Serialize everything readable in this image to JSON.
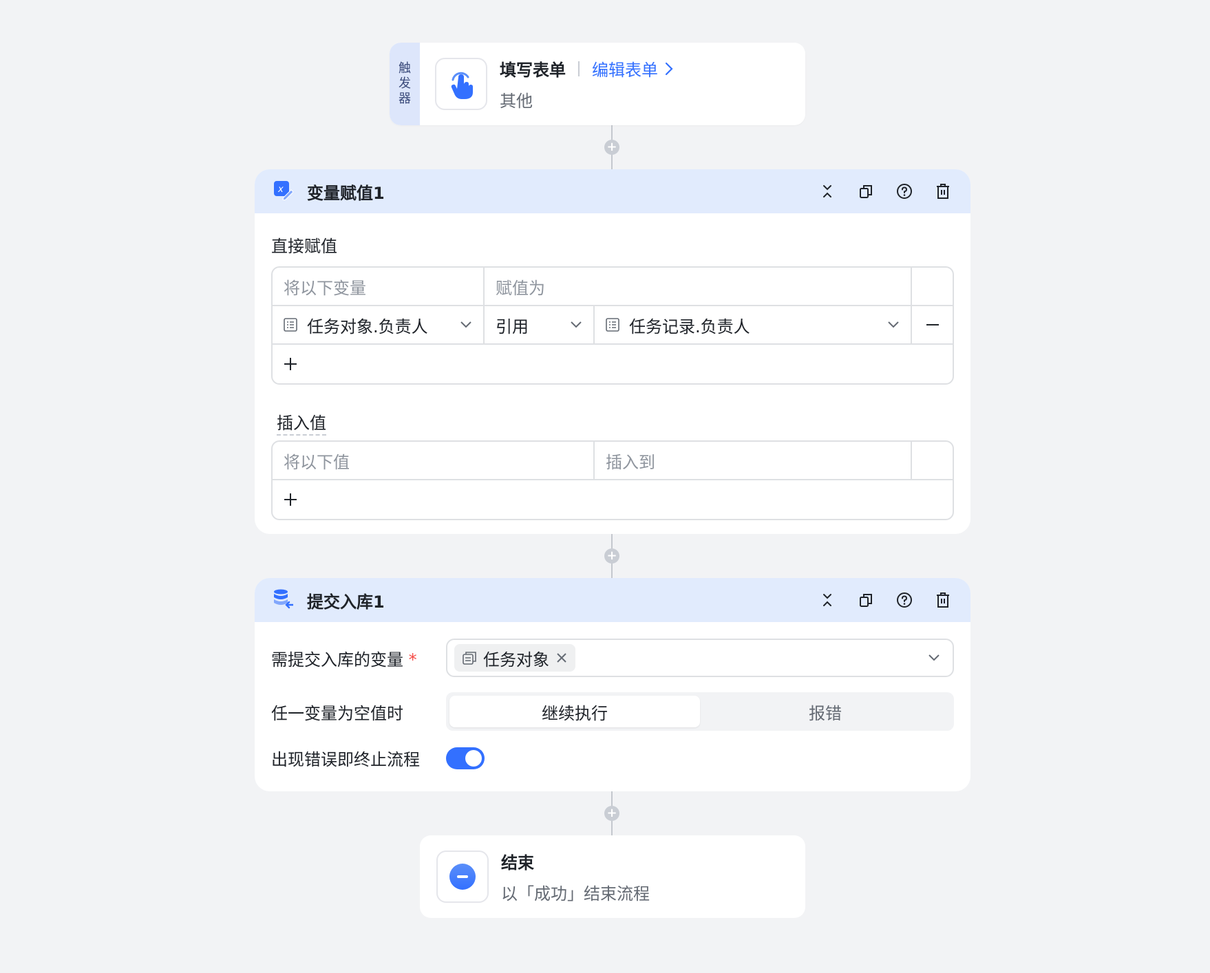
{
  "trigger": {
    "tag_chars": [
      "触",
      "发",
      "器"
    ],
    "title": "填写表单",
    "edit_link": "编辑表单",
    "subtitle": "其他",
    "icon": "pointer-hand-icon"
  },
  "assign_node": {
    "title": "变量赋值1",
    "icon": "variable-edit-icon",
    "actions": [
      "collapse-icon",
      "copy-icon",
      "help-icon",
      "delete-icon"
    ],
    "direct": {
      "label": "直接赋值",
      "headers": [
        "将以下变量",
        "赋值为"
      ],
      "rows": [
        {
          "variable": "任务对象.负责人",
          "mode": "引用",
          "value": "任务记录.负责人"
        }
      ]
    },
    "insert": {
      "label": "插入值",
      "headers": [
        "将以下值",
        "插入到"
      ]
    }
  },
  "submit_node": {
    "title": "提交入库1",
    "icon": "database-icon",
    "actions": [
      "collapse-icon",
      "copy-icon",
      "help-icon",
      "delete-icon"
    ],
    "vars_label": "需提交入库的变量",
    "required_mark": "*",
    "selected_var": "任务对象",
    "empty_label": "任一变量为空值时",
    "empty_options": [
      "继续执行",
      "报错"
    ],
    "empty_selected": "继续执行",
    "stop_label": "出现错误即终止流程",
    "stop_on_error": true
  },
  "end_node": {
    "title": "结束",
    "subtitle": "以「成功」结束流程",
    "icon": "minus-circle-icon"
  },
  "colors": {
    "accent": "#3370ff",
    "header_bg": "#e1ebfd",
    "page_bg": "#f2f3f5",
    "required": "#f54a45"
  }
}
